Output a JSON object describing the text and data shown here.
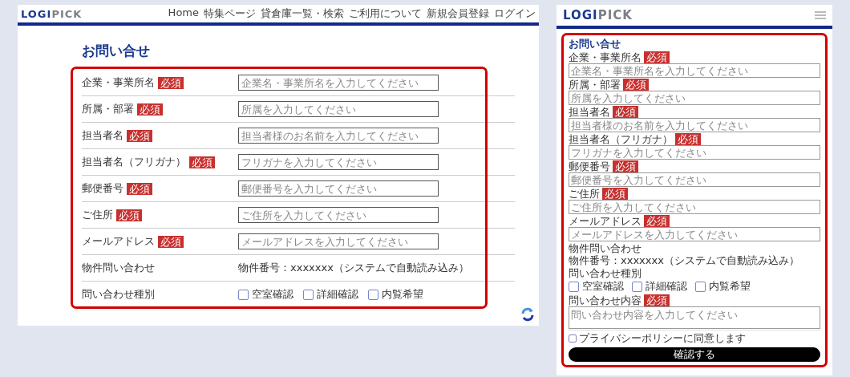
{
  "desktop": {
    "logo": {
      "primary": "LOGI",
      "secondary": "PICK"
    },
    "nav": [
      "Home",
      "特集ページ",
      "貸倉庫一覧・検索",
      "ご利用について",
      "新規会員登録",
      "ログイン"
    ],
    "title": "お問い合せ",
    "fields": [
      {
        "label": "企業・事業所名",
        "required": true,
        "badge": "必須",
        "placeholder": "企業名・事業所名を入力してください"
      },
      {
        "label": "所属・部署",
        "required": true,
        "badge": "必須",
        "placeholder": "所属を入力してください"
      },
      {
        "label": "担当者名",
        "required": true,
        "badge": "必須",
        "placeholder": "担当者様のお名前を入力してください"
      },
      {
        "label": "担当者名（フリガナ）",
        "required": true,
        "badge": "必須",
        "placeholder": "フリガナを入力してください"
      },
      {
        "label": "郵便番号",
        "required": true,
        "badge": "必須",
        "placeholder": "郵便番号を入力してください"
      },
      {
        "label": "ご住所",
        "required": true,
        "badge": "必須",
        "placeholder": "ご住所を入力してください"
      },
      {
        "label": "メールアドレス",
        "required": true,
        "badge": "必須",
        "placeholder": "メールアドレスを入力してください"
      }
    ],
    "property": {
      "label": "物件問い合わせ",
      "value": "物件番号：xxxxxxx（システムで自動読み込み）"
    },
    "inquiry_type": {
      "label": "問い合わせ種別",
      "options": [
        {
          "label": "空室確認",
          "checked": false
        },
        {
          "label": "詳細確認",
          "checked": false
        },
        {
          "label": "内覧希望",
          "checked": false
        }
      ]
    }
  },
  "mobile": {
    "logo": {
      "primary": "LOGI",
      "secondary": "PICK"
    },
    "title": "お問い合せ",
    "fields": [
      {
        "label": "企業・事業所名",
        "required": true,
        "badge": "必須",
        "placeholder": "企業名・事業所名を入力してください"
      },
      {
        "label": "所属・部署",
        "required": true,
        "badge": "必須",
        "placeholder": "所属を入力してください"
      },
      {
        "label": "担当者名",
        "required": true,
        "badge": "必須",
        "placeholder": "担当者様のお名前を入力してください"
      },
      {
        "label": "担当者名（フリガナ）",
        "required": true,
        "badge": "必須",
        "placeholder": "フリガナを入力してください"
      },
      {
        "label": "郵便番号",
        "required": true,
        "badge": "必須",
        "placeholder": "郵便番号を入力してください"
      },
      {
        "label": "ご住所",
        "required": true,
        "badge": "必須",
        "placeholder": "ご住所を入力してください"
      },
      {
        "label": "メールアドレス",
        "required": true,
        "badge": "必須",
        "placeholder": "メールアドレスを入力してください"
      }
    ],
    "property": {
      "label": "物件問い合わせ",
      "value": "物件番号：xxxxxxx（システムで自動読み込み）"
    },
    "inquiry_type": {
      "label": "問い合わせ種別",
      "options": [
        {
          "label": "空室確認",
          "checked": false
        },
        {
          "label": "詳細確認",
          "checked": false
        },
        {
          "label": "内覧希望",
          "checked": false
        }
      ]
    },
    "content": {
      "label": "問い合わせ内容",
      "required": true,
      "badge": "必須",
      "placeholder": "問い合わせ内容を入力してください"
    },
    "agreement": {
      "label": "プライバシーポリシーに同意します",
      "checked": false
    },
    "submit": "確認する"
  }
}
